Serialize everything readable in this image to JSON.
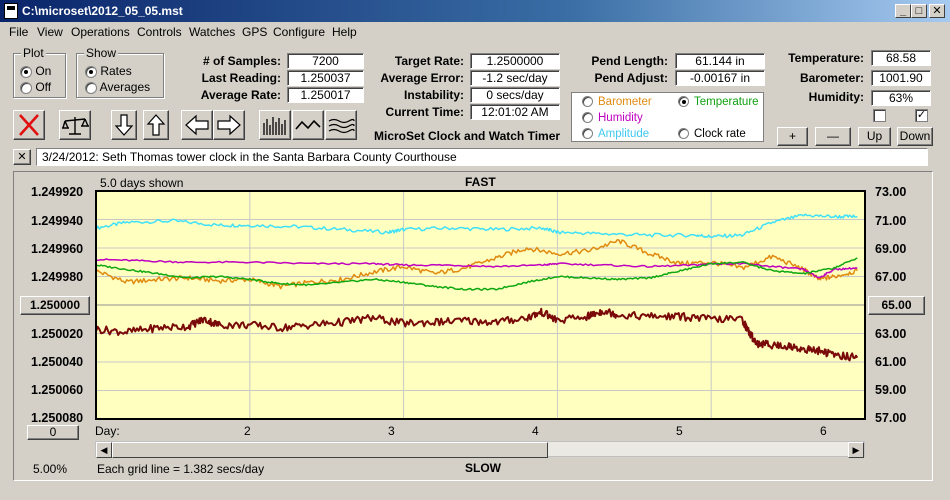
{
  "window": {
    "title": "C:\\microset\\2012_05_05.mst"
  },
  "menu": [
    "File",
    "View",
    "Operations",
    "Controls",
    "Watches",
    "GPS",
    "Configure",
    "Help"
  ],
  "plot_group": {
    "title": "Plot",
    "options": [
      "On",
      "Off"
    ],
    "selected": "On"
  },
  "show_group": {
    "title": "Show",
    "options": [
      "Rates",
      "Averages"
    ],
    "selected": "Rates"
  },
  "stats": {
    "samples_label": "# of Samples:",
    "samples": "7200",
    "last_label": "Last Reading:",
    "last": "1.250037",
    "avg_rate_label": "Average Rate:",
    "avg_rate": "1.250017"
  },
  "rates": {
    "target_label": "Target Rate:",
    "target": "1.2500000",
    "avg_error_label": "Average Error:",
    "avg_error": "-1.2 sec/day",
    "instability_label": "Instability:",
    "instability": "0 secs/day",
    "time_label": "Current Time:",
    "time": "12:01:02 AM"
  },
  "pend": {
    "length_label": "Pend Length:",
    "length": "61.144 in",
    "adjust_label": "Pend Adjust:",
    "adjust": "-0.00167 in"
  },
  "env": {
    "temp_label": "Temperature:",
    "temp": "68.58",
    "baro_label": "Barometer:",
    "baro": "1001.90",
    "hum_label": "Humidity:",
    "hum": "63%"
  },
  "app_caption": "MicroSet Clock and Watch Timer",
  "sensor_options": [
    {
      "label": "Barometer",
      "color": "#e08a10",
      "selected": false
    },
    {
      "label": "Temperature",
      "color": "#10a010",
      "selected": true
    },
    {
      "label": "Humidity",
      "color": "#c000c0",
      "selected": false
    },
    {
      "label": "Amplitude",
      "color": "#40c8f0",
      "selected": false
    },
    {
      "label": "Clock rate",
      "color": "#000000",
      "selected": false
    }
  ],
  "checkboxes": [
    {
      "checked": false
    },
    {
      "checked": true
    }
  ],
  "adjust_buttons": [
    "+",
    "—",
    "Up",
    "Down"
  ],
  "note": {
    "close": "✕",
    "text": "3/24/2012: Seth Thomas tower clock in the Santa Barbara County Courthouse"
  },
  "icons": {
    "close": "red-x-icon",
    "scale": "balance-scale-icon",
    "down": "arrow-down-icon",
    "up": "arrow-up-icon",
    "left": "arrow-left-icon",
    "right": "arrow-right-icon",
    "bars": "bar-graph-icon",
    "wave": "wave-icon",
    "waves": "multi-wave-icon"
  },
  "chart_data": {
    "type": "line",
    "days_shown_label": "5.0 days shown",
    "top_label": "FAST",
    "bottom_label": "SLOW",
    "left_axis_ticks": [
      "1.249920",
      "1.249940",
      "1.249960",
      "1.249980",
      "1.250000",
      "1.250020",
      "1.250040",
      "1.250060",
      "1.250080"
    ],
    "left_center_button": "1.250000",
    "right_axis_ticks": [
      "73.00",
      "71.00",
      "69.00",
      "67.00",
      "65.00",
      "63.00",
      "61.00",
      "59.00",
      "57.00"
    ],
    "right_center_button": "65.00",
    "x_label_prefix": "Day:",
    "x_ticks": [
      "2",
      "3",
      "4",
      "5",
      "6"
    ],
    "ylim_left": [
      1.25008,
      1.24992
    ],
    "ylim_right": [
      57,
      73
    ],
    "xlim": [
      1,
      6
    ],
    "left_bottom_button": "0",
    "percent": "5.00%",
    "grid_note": "Each grid line = 1.382 secs/day",
    "background": "#ffffc0",
    "grid": true,
    "series": [
      {
        "key": "amplitude",
        "color": "#40e0f8",
        "axis": "right",
        "width": 1.5,
        "x": [
          1.0,
          1.2,
          1.5,
          1.8,
          2.0,
          2.3,
          2.6,
          2.9,
          3.0,
          3.3,
          3.6,
          3.9,
          4.0,
          4.3,
          4.6,
          4.9,
          5.0,
          5.2,
          5.4,
          5.6,
          5.8,
          5.95
        ],
        "y": [
          70.4,
          70.8,
          70.9,
          70.6,
          70.6,
          70.5,
          70.3,
          70.1,
          70.3,
          70.4,
          70.3,
          70.4,
          70.1,
          70.0,
          69.9,
          69.9,
          69.8,
          69.9,
          70.8,
          71.3,
          71.2,
          71.2
        ]
      },
      {
        "key": "barometer",
        "color": "#e08a10",
        "axis": "right",
        "width": 1.5,
        "x": [
          1.0,
          1.2,
          1.4,
          1.6,
          1.8,
          2.0,
          2.2,
          2.4,
          2.6,
          2.8,
          3.0,
          3.2,
          3.4,
          3.6,
          3.8,
          4.0,
          4.2,
          4.4,
          4.6,
          4.8,
          5.0,
          5.2,
          5.4,
          5.6,
          5.7,
          5.8,
          5.95
        ],
        "y": [
          67.4,
          66.6,
          66.8,
          66.9,
          66.7,
          66.8,
          66.3,
          66.6,
          66.8,
          67.3,
          67.7,
          67.2,
          67.6,
          68.3,
          69.0,
          68.6,
          68.8,
          69.5,
          68.6,
          67.9,
          68.0,
          67.6,
          68.4,
          67.5,
          66.8,
          67.0,
          67.4
        ]
      },
      {
        "key": "humidity",
        "color": "#c000c0",
        "axis": "right",
        "width": 1.5,
        "x": [
          1.0,
          1.3,
          1.6,
          2.0,
          2.4,
          2.8,
          3.0,
          3.3,
          3.6,
          3.9,
          4.0,
          4.3,
          4.6,
          4.9,
          5.0,
          5.2,
          5.4,
          5.6,
          5.7,
          5.8,
          5.95
        ],
        "y": [
          68.2,
          68.1,
          68.0,
          68.0,
          67.9,
          67.9,
          67.8,
          67.8,
          67.7,
          67.8,
          67.9,
          67.8,
          67.7,
          67.8,
          67.9,
          67.9,
          67.7,
          67.5,
          66.9,
          67.5,
          67.6
        ]
      },
      {
        "key": "temperature",
        "color": "#10a810",
        "axis": "right",
        "width": 1.5,
        "x": [
          1.0,
          1.2,
          1.4,
          1.6,
          1.8,
          2.0,
          2.2,
          2.4,
          2.6,
          2.8,
          3.0,
          3.2,
          3.4,
          3.6,
          3.8,
          4.0,
          4.2,
          4.4,
          4.6,
          4.8,
          5.0,
          5.2,
          5.4,
          5.6,
          5.8,
          5.95
        ],
        "y": [
          67.8,
          67.5,
          67.2,
          66.9,
          67.0,
          66.8,
          66.5,
          66.4,
          66.6,
          66.8,
          66.6,
          66.3,
          66.1,
          66.1,
          66.6,
          67.0,
          66.9,
          66.8,
          66.9,
          67.4,
          67.9,
          68.0,
          67.4,
          67.2,
          67.6,
          68.3
        ]
      },
      {
        "key": "clock-rate",
        "color": "#7a0a0a",
        "axis": "right",
        "width": 2,
        "x": [
          1.0,
          1.2,
          1.4,
          1.6,
          1.7,
          1.8,
          2.0,
          2.2,
          2.4,
          2.6,
          2.8,
          3.0,
          3.2,
          3.4,
          3.6,
          3.8,
          3.9,
          4.0,
          4.2,
          4.3,
          4.4,
          4.6,
          4.8,
          5.0,
          5.2,
          5.25,
          5.3,
          5.4,
          5.5,
          5.6,
          5.7,
          5.8,
          5.95
        ],
        "y": [
          63.3,
          63.1,
          63.4,
          63.5,
          64.0,
          63.6,
          63.6,
          63.4,
          63.6,
          63.8,
          64.1,
          63.7,
          63.8,
          63.9,
          63.8,
          64.1,
          64.5,
          63.9,
          64.2,
          64.6,
          64.3,
          64.2,
          64.2,
          64.0,
          64.0,
          63.0,
          62.3,
          62.2,
          62.1,
          61.9,
          61.8,
          61.5,
          61.3
        ]
      }
    ]
  }
}
